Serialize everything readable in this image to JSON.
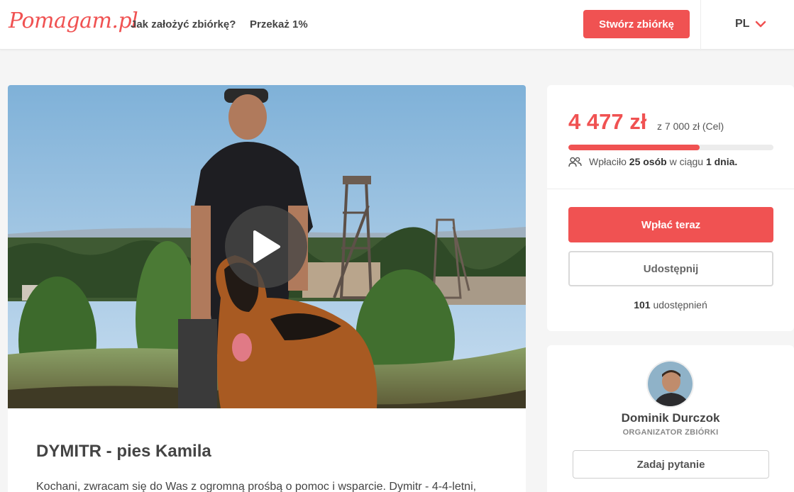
{
  "header": {
    "logo": "Pomagam.pl",
    "nav": [
      "Jak założyć zbiórkę?",
      "Przekaż 1%"
    ],
    "create_label": "Stwórz zbiórkę",
    "lang": "PL"
  },
  "campaign": {
    "title": "DYMITR - pies Kamila",
    "description": "Kochani, zwracam się do Was z ogromną prośbą o pomoc i wsparcie. Dymitr - 4-4-letni,"
  },
  "donation": {
    "raised": "4 477 zł",
    "goal": "z 7 000 zł (Cel)",
    "progress_fraction": 0.64,
    "donors_prefix": "Wpłaciło",
    "donors_count": "25 osób",
    "donors_mid": "w ciągu",
    "donors_period": "1 dnia.",
    "pay_label": "Wpłać teraz",
    "share_label": "Udostępnij",
    "shares_count": "101",
    "shares_label": "udostępnień"
  },
  "organizer": {
    "name": "Dominik Durczok",
    "role": "ORGANIZATOR ZBIÓRKI",
    "ask_label": "Zadaj pytanie"
  },
  "colors": {
    "accent": "#f05252"
  },
  "icons": [
    "chevron-down-icon",
    "play-icon",
    "people-icon"
  ]
}
